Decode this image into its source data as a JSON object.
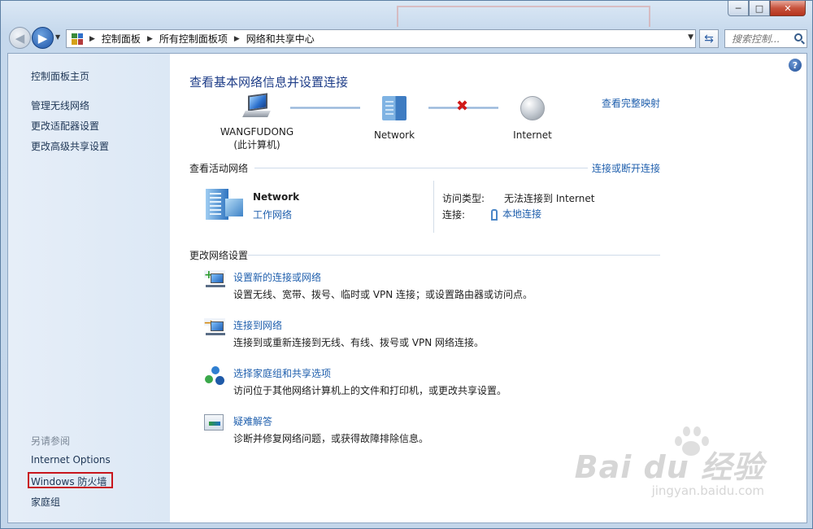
{
  "window": {
    "caption_buttons": {
      "minimize": "─",
      "maximize": "□",
      "close": "✕"
    }
  },
  "navbar": {
    "back_icon": "back-arrow-icon",
    "forward_icon": "forward-arrow-icon",
    "breadcrumbs": [
      "控制面板",
      "所有控制面板项",
      "网络和共享中心"
    ],
    "search_placeholder": "搜索控制...",
    "refresh_icon": "refresh-icon"
  },
  "sidebar": {
    "home_link": "控制面板主页",
    "links": [
      "管理无线网络",
      "更改适配器设置",
      "更改高级共享设置"
    ],
    "see_also_heading": "另请参阅",
    "see_also_links": [
      "Internet Options",
      "Windows 防火墙",
      "家庭组"
    ],
    "highlight_color": "#c8161d"
  },
  "main": {
    "title": "查看基本网络信息并设置连接",
    "view_full_map": "查看完整映射",
    "map": {
      "computer_name": "WANGFUDONG",
      "computer_sub": "(此计算机)",
      "network": "Network",
      "internet": "Internet"
    },
    "active_networks": {
      "label": "查看活动网络",
      "connect_link": "连接或断开连接",
      "network_name": "Network",
      "network_type": "工作网络",
      "access_type_label": "访问类型:",
      "access_type_value": "无法连接到 Internet",
      "connections_label": "连接:",
      "connections_value": "本地连接"
    },
    "change_settings": {
      "label": "更改网络设置",
      "tasks": [
        {
          "title": "设置新的连接或网络",
          "desc": "设置无线、宽带、拨号、临时或 VPN 连接；或设置路由器或访问点。"
        },
        {
          "title": "连接到网络",
          "desc": "连接到或重新连接到无线、有线、拨号或 VPN 网络连接。"
        },
        {
          "title": "选择家庭组和共享选项",
          "desc": "访问位于其他网络计算机上的文件和打印机，或更改共享设置。"
        },
        {
          "title": "疑难解答",
          "desc": "诊断并修复网络问题，或获得故障排除信息。"
        }
      ]
    }
  },
  "watermark": {
    "brand": "Bai du 经验",
    "url": "jingyan.baidu.com"
  },
  "colors": {
    "link": "#1f5fad",
    "title": "#1e3d88",
    "error_x": "#d01919"
  }
}
